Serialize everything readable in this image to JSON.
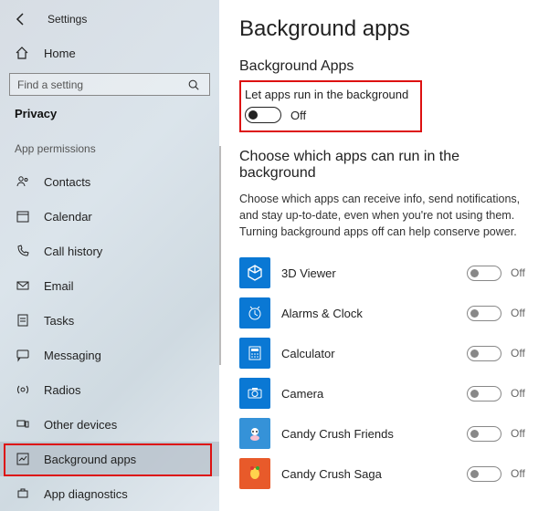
{
  "header": {
    "settings": "Settings"
  },
  "home": {
    "label": "Home"
  },
  "search": {
    "placeholder": "Find a setting"
  },
  "category": "Privacy",
  "group_label": "App permissions",
  "sidebar": {
    "items": [
      {
        "label": "Contacts"
      },
      {
        "label": "Calendar"
      },
      {
        "label": "Call history"
      },
      {
        "label": "Email"
      },
      {
        "label": "Tasks"
      },
      {
        "label": "Messaging"
      },
      {
        "label": "Radios"
      },
      {
        "label": "Other devices"
      },
      {
        "label": "Background apps"
      },
      {
        "label": "App diagnostics"
      }
    ]
  },
  "main": {
    "title": "Background apps",
    "subtitle1": "Background Apps",
    "master_toggle_label": "Let apps run in the background",
    "master_toggle_state": "Off",
    "subtitle2": "Choose which apps can run in the background",
    "description": "Choose which apps can receive info, send notifications, and stay up-to-date, even when you're not using them. Turning background apps off can help conserve power.",
    "apps": [
      {
        "name": "3D Viewer",
        "state": "Off",
        "icon": "cube"
      },
      {
        "name": "Alarms & Clock",
        "state": "Off",
        "icon": "clock"
      },
      {
        "name": "Calculator",
        "state": "Off",
        "icon": "calc"
      },
      {
        "name": "Camera",
        "state": "Off",
        "icon": "camera"
      },
      {
        "name": "Candy Crush Friends",
        "state": "Off",
        "icon": "candyf"
      },
      {
        "name": "Candy Crush Saga",
        "state": "Off",
        "icon": "candys"
      }
    ]
  }
}
